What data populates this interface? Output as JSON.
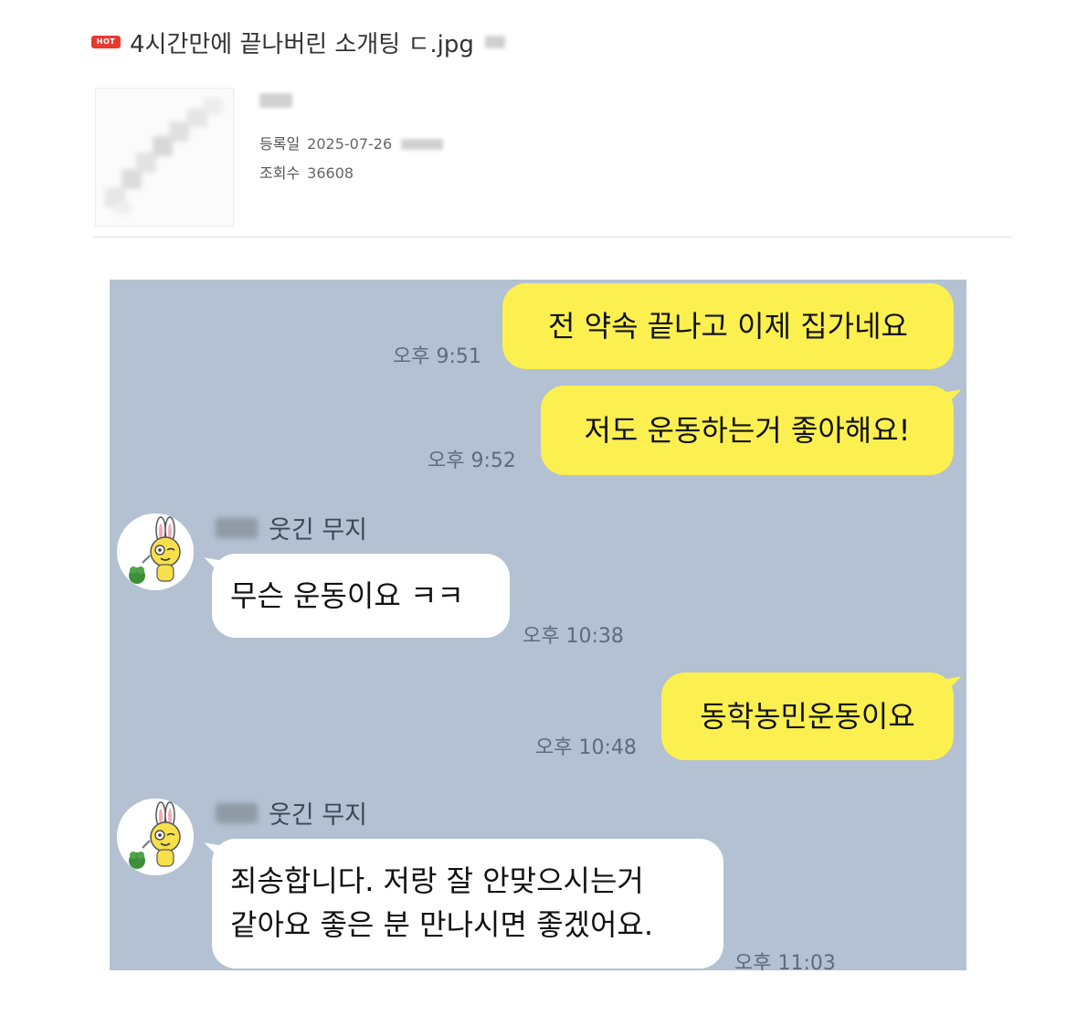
{
  "post": {
    "hot_badge": "HOT",
    "title": "4시간만에 끝나버린 소개팅 ㄷ.jpg",
    "registered_label": "등록일",
    "registered_date": "2025-07-26",
    "views_label": "조회수",
    "views": "36608"
  },
  "chat": {
    "background_color": "#b3c1d2",
    "my_bubble_color": "#fbf04f",
    "other_bubble_color": "#ffffff",
    "messages": [
      {
        "from": "me",
        "text": "전 약속 끝나고 이제 집가네요",
        "time": "오후 9:51"
      },
      {
        "from": "me",
        "text": "저도 운동하는거 좋아해요!",
        "time": "오후 9:52"
      },
      {
        "from": "other",
        "sender": "웃긴 무지",
        "text": "무슨 운동이요 ㅋㅋ",
        "time": "오후 10:38"
      },
      {
        "from": "me",
        "text": "동학농민운동이요",
        "time": "오후 10:48"
      },
      {
        "from": "other",
        "sender": "웃긴 무지",
        "lines": [
          "죄송합니다. 저랑 잘 안맞으시는거",
          "같아요 좋은 분 만나시면 좋겠어요."
        ],
        "time": "오후 11:03"
      }
    ]
  },
  "icons": {
    "avatar": "muzi-character-avatar",
    "thumbnail": "blurred-thumbnail-image"
  }
}
